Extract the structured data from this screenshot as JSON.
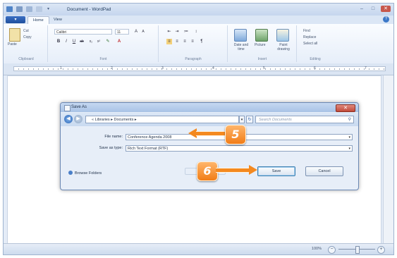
{
  "window": {
    "title": "Document - WordPad"
  },
  "ribbon": {
    "app_menu": "▾",
    "tabs": [
      "Home",
      "View"
    ],
    "clipboard": {
      "paste": "Paste",
      "cut": "Cut",
      "copy": "Copy",
      "label": "Clipboard"
    },
    "font": {
      "family": "Calibri",
      "size": "11",
      "label": "Font"
    },
    "paragraph": {
      "label": "Paragraph"
    },
    "insert": {
      "date_time": "Date and time",
      "picture": "Picture",
      "paint": "Paint drawing",
      "label": "Insert"
    },
    "editing": {
      "find": "Find",
      "replace": "Replace",
      "select_all": "Select all",
      "label": "Editing"
    }
  },
  "ruler": {
    "numbers": [
      "1",
      "2",
      "3",
      "4",
      "5",
      "6",
      "7"
    ]
  },
  "statusbar": {
    "zoom": "100%"
  },
  "dialog": {
    "title": "Save As",
    "breadcrumb": "« Libraries ▸ Documents ▸",
    "search_placeholder": "Search Documents",
    "filename_label": "File name:",
    "filename_value": "Conference Agenda 2008",
    "savetype_label": "Save as type:",
    "savetype_value": "Rich Text Format (RTF)",
    "browse_folders": "Browse Folders",
    "save": "Save",
    "cancel": "Cancel"
  },
  "callouts": {
    "step5": "5",
    "step6": "6"
  },
  "colors": {
    "callout": "#f4891f",
    "accent": "#2c66b6"
  }
}
